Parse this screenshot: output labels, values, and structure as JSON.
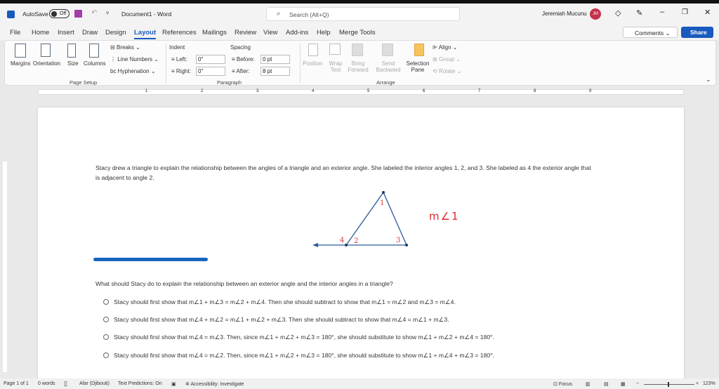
{
  "titlebar": {
    "autosave": "AutoSave",
    "toggle": "Off",
    "doc_title": "Document1 - Word",
    "search_placeholder": "Search (Alt+Q)",
    "user": "Jeremiah Mucunu",
    "initials": "JM"
  },
  "tabs": [
    "File",
    "Home",
    "Insert",
    "Draw",
    "Design",
    "Layout",
    "References",
    "Mailings",
    "Review",
    "View",
    "Add-ins",
    "Help",
    "Merge Tools"
  ],
  "comments": "Comments",
  "share": "Share",
  "ribbon": {
    "page_setup": {
      "margins": "Margins",
      "orientation": "Orientation",
      "size": "Size",
      "columns": "Columns",
      "breaks": "Breaks",
      "line_numbers": "Line Numbers",
      "hyphenation": "Hyphenation",
      "label": "Page Setup"
    },
    "paragraph": {
      "indent": "Indent",
      "spacing": "Spacing",
      "left_label": "Left:",
      "left_value": "0\"",
      "right_label": "Right:",
      "right_value": "0\"",
      "before_label": "Before:",
      "before_value": "0 pt",
      "after_label": "After:",
      "after_value": "8 pt",
      "label": "Paragraph"
    },
    "arrange": {
      "position": "Position",
      "wrap_text": "Wrap Text",
      "bring_forward": "Bring Forward",
      "send_backward": "Send Backward",
      "selection_pane": "Selection Pane",
      "align": "Align",
      "group": "Group",
      "rotate": "Rotate",
      "label": "Arrange"
    }
  },
  "document": {
    "intro_line1": "Stacy drew a triangle to explain the relationship between the angles of a triangle and an exterior angle. She labeled the interior angles 1, 2, and 3. She labeled as 4 the exterior angle that",
    "intro_line2": "is adjacent to angle 2.",
    "figure_labels": {
      "a1": "1",
      "a2": "2",
      "a3": "3",
      "a4": "4"
    },
    "handwritten": "m∠1",
    "question": "What should Stacy do to explain the relationship between an exterior angle and the interior angles in a triangle?",
    "options": [
      "Stacy should first show that m∠1 + m∠3 = m∠2 + m∠4. Then she should subtract to show that m∠1 = m∠2 and m∠3 = m∠4.",
      "Stacy should first show that m∠4 + m∠2 = m∠1 + m∠2 + m∠3. Then she should subtract to show that m∠4 = m∠1 + m∠3.",
      "Stacy should first show that m∠4 = m∠3. Then, since m∠1 + m∠2 + m∠3 = 180°, she should substitute to show m∠1 + m∠2 + m∠4 = 180°.",
      "Stacy should first show that m∠4 = m∠2. Then, since m∠1 + m∠2 + m∠3 = 180°, she should substitute to show m∠1 + m∠4 + m∠3 = 180°."
    ]
  },
  "status": {
    "page": "Page 1 of 1",
    "words": "0 words",
    "language": "Afar (Djibouti)",
    "predictions": "Text Predictions: On",
    "accessibility": "Accessibility: Investigate",
    "focus": "Focus",
    "zoom": "123%"
  },
  "ruler_numbers": [
    "1",
    "2",
    "3",
    "4",
    "5",
    "6",
    "7",
    "8",
    "9"
  ],
  "colors": {
    "accent": "#185abd",
    "avatar": "#c4314b",
    "ink_red": "#e0282e",
    "ink_blue": "#1565c0"
  }
}
